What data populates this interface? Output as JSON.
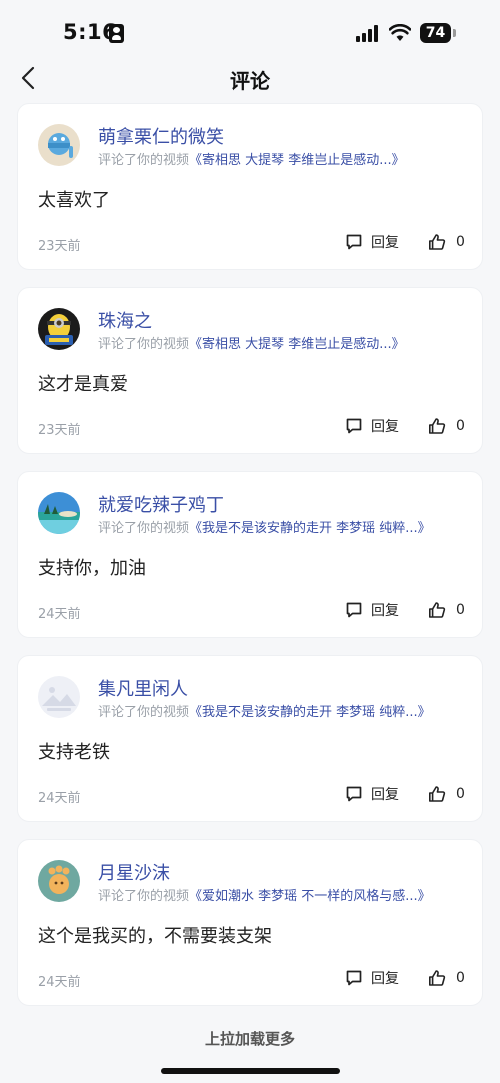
{
  "status_bar": {
    "time": "5:16",
    "battery": "74"
  },
  "nav": {
    "title": "评论"
  },
  "comments": [
    {
      "user": "萌拿栗仁的微笑",
      "action": "评论了你的视频",
      "video": "《寄相思 大提琴 李维岂止是感动...》",
      "text": "太喜欢了",
      "time": "23天前",
      "reply_label": "回复",
      "likes": "0"
    },
    {
      "user": "珠海之",
      "action": "评论了你的视频",
      "video": "《寄相思 大提琴 李维岂止是感动...》",
      "text": "这才是真爱",
      "time": "23天前",
      "reply_label": "回复",
      "likes": "0"
    },
    {
      "user": "就爱吃辣子鸡丁",
      "action": "评论了你的视频",
      "video": "《我是不是该安静的走开 李梦瑶 纯粹...》",
      "text": "支持你，加油",
      "time": "24天前",
      "reply_label": "回复",
      "likes": "0"
    },
    {
      "user": "集凡里闲人",
      "action": "评论了你的视频",
      "video": "《我是不是该安静的走开 李梦瑶 纯粹...》",
      "text": "支持老铁",
      "time": "24天前",
      "reply_label": "回复",
      "likes": "0"
    },
    {
      "user": "月星沙沫",
      "action": "评论了你的视频",
      "video": "《爱如潮水 李梦瑶 不一样的风格与感...》",
      "text": "这个是我买的，不需要装支架",
      "time": "24天前",
      "reply_label": "回复",
      "likes": "0"
    }
  ],
  "footer": {
    "load_more": "上拉加载更多"
  },
  "icons": {
    "back": "chevron-left-icon",
    "reply": "comment-bubble-icon",
    "like": "thumbs-up-icon"
  },
  "colors": {
    "link": "#3a4fa6",
    "muted": "#9aa0a8",
    "background": "#f6f7f9"
  }
}
